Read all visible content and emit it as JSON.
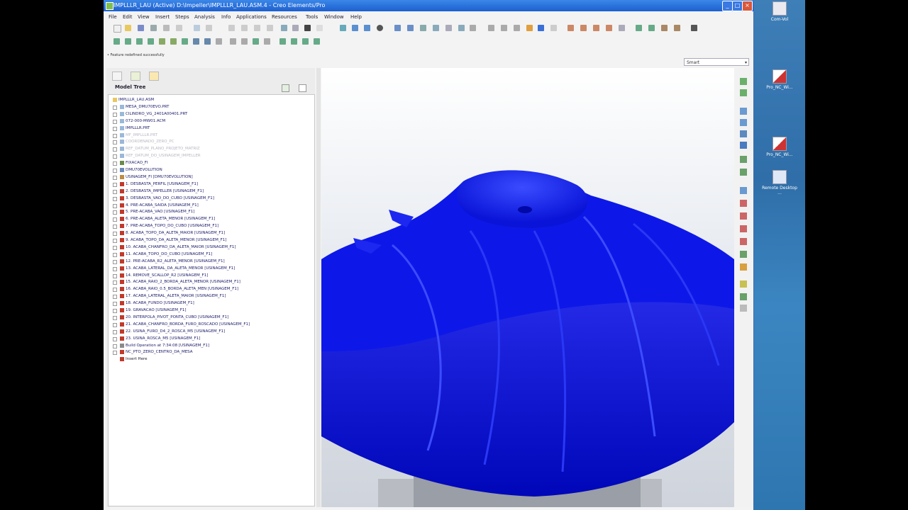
{
  "window": {
    "title": "IMPLLLR_LAU (Active) D:\\Impeller\\IMPLLLR_LAU.ASM.4 - Creo Elements/Pro",
    "minimize": "_",
    "maximize": "□",
    "close": "×"
  },
  "menu": [
    "File",
    "Edit",
    "View",
    "Insert",
    "Steps",
    "Analysis",
    "Info",
    "Applications",
    "Resources",
    "Tools",
    "Window",
    "Help"
  ],
  "status_message": "• Feature redefined successfully",
  "filter": {
    "value": "Smart"
  },
  "model_tree": {
    "title": "Model Tree",
    "rows": [
      {
        "text": "IMPLLLR_LAU.ASM",
        "dim": false,
        "icon": "assembly-icon",
        "indent": 0
      },
      {
        "text": "MESA_DMU70EVO.PRT",
        "dim": false,
        "icon": "part-icon",
        "indent": 1
      },
      {
        "text": "CILINDRO_VG_2401A00401.PRT",
        "dim": false,
        "icon": "part-icon",
        "indent": 1
      },
      {
        "text": "072-000-MW01.ACM",
        "dim": false,
        "icon": "part-icon",
        "indent": 1
      },
      {
        "text": "IMPLLLR.PRT",
        "dim": false,
        "icon": "part-icon",
        "indent": 1
      },
      {
        "text": "MF_IMPLLLR.PRT",
        "dim": true,
        "icon": "part-icon",
        "indent": 1
      },
      {
        "text": "COORDENADO_ZERO_PC",
        "dim": true,
        "icon": "part-icon",
        "indent": 1
      },
      {
        "text": "REF_DATUM_PLANO_PROJETO_MATRIZ",
        "dim": true,
        "icon": "part-icon",
        "indent": 1
      },
      {
        "text": "REF_DATUM_DO_USINAGEM_IMPELLER",
        "dim": true,
        "icon": "part-icon",
        "indent": 1
      },
      {
        "text": "FIXACAO_FI",
        "dim": false,
        "icon": "fixture-icon",
        "indent": 1
      },
      {
        "text": "DMU70EVOLUTION",
        "dim": false,
        "icon": "machine-icon",
        "indent": 1
      },
      {
        "text": "USINAGEM_FI [DMU70EVOLUTION]",
        "dim": false,
        "icon": "operation-icon",
        "indent": 1
      },
      {
        "text": "1. DESBASTA_PERFIL [USINAGEM_F1]",
        "dim": false,
        "icon": "sequence-icon",
        "indent": 1
      },
      {
        "text": "2. DESBASTA_IMPELLER [USINAGEM_F1]",
        "dim": false,
        "icon": "sequence-icon",
        "indent": 1
      },
      {
        "text": "3. DESBASTA_VAO_DO_CUBO [USINAGEM_F1]",
        "dim": false,
        "icon": "sequence-icon",
        "indent": 1
      },
      {
        "text": "4. PRE-ACABA_SAIDA [USINAGEM_F1]",
        "dim": false,
        "icon": "sequence-icon",
        "indent": 1
      },
      {
        "text": "5. PRE-ACABA_VAO [USINAGEM_F1]",
        "dim": false,
        "icon": "sequence-icon",
        "indent": 1
      },
      {
        "text": "6. PRE-ACABA_ALETA_MENOR [USINAGEM_F1]",
        "dim": false,
        "icon": "sequence-icon",
        "indent": 1
      },
      {
        "text": "7. PRE-ACABA_TOPO_DO_CUBO [USINAGEM_F1]",
        "dim": false,
        "icon": "sequence-icon",
        "indent": 1
      },
      {
        "text": "8. ACABA_TOPO_DA_ALETA_MAIOR [USINAGEM_F1]",
        "dim": false,
        "icon": "sequence-icon",
        "indent": 1
      },
      {
        "text": "9. ACABA_TOPO_DA_ALETA_MENOR [USINAGEM_F1]",
        "dim": false,
        "icon": "sequence-icon",
        "indent": 1
      },
      {
        "text": "10. ACABA_CHANFRO_DA_ALETA_MAIOR [USINAGEM_F1]",
        "dim": false,
        "icon": "sequence-icon",
        "indent": 1
      },
      {
        "text": "11. ACABA_TOPO_DO_CUBO [USINAGEM_F1]",
        "dim": false,
        "icon": "sequence-icon",
        "indent": 1
      },
      {
        "text": "12. PRE-ACABA_R2_ALETA_MENOR [USINAGEM_F1]",
        "dim": false,
        "icon": "sequence-icon",
        "indent": 1
      },
      {
        "text": "13. ACABA_LATERAL_DA_ALETA_MENOR [USINAGEM_F1]",
        "dim": false,
        "icon": "sequence-icon",
        "indent": 1
      },
      {
        "text": "14. REMOVE_SCALLOP_R2 [USINAGEM_F1]",
        "dim": false,
        "icon": "sequence-icon",
        "indent": 1
      },
      {
        "text": "15. ACABA_RAIO_2_BORDA_ALETA_MENOR [USINAGEM_F1]",
        "dim": false,
        "icon": "sequence-icon",
        "indent": 1
      },
      {
        "text": "16. ACABA_RAIO_0.5_BORDA_ALETA_MEN [USINAGEM_F1]",
        "dim": false,
        "icon": "sequence-icon",
        "indent": 1
      },
      {
        "text": "17. ACABA_LATERAL_ALETA_MAIOR [USINAGEM_F1]",
        "dim": false,
        "icon": "sequence-icon",
        "indent": 1
      },
      {
        "text": "18. ACABA_FUNDO [USINAGEM_F1]",
        "dim": false,
        "icon": "sequence-icon",
        "indent": 1
      },
      {
        "text": "19. GRAVACAO [USINAGEM_F1]",
        "dim": false,
        "icon": "sequence-icon",
        "indent": 1
      },
      {
        "text": "20. INTERPOLA_PIVOT_PONTA_CUBO [USINAGEM_F1]",
        "dim": false,
        "icon": "sequence-icon",
        "indent": 1
      },
      {
        "text": "21. ACABA_CHANFRO_BORDA_FURO_ROSCADO [USINAGEM_F1]",
        "dim": false,
        "icon": "sequence-icon",
        "indent": 1
      },
      {
        "text": "22. USINA_FURO_D4_2_ROSCA_M5 [USINAGEM_F1]",
        "dim": false,
        "icon": "sequence-icon",
        "indent": 1
      },
      {
        "text": "23. USINA_ROSCA_M5 [USINAGEM_F1]",
        "dim": false,
        "icon": "sequence-icon",
        "indent": 1
      },
      {
        "text": "Build Operation at 7:34:08 [USINAGEM_F1]",
        "dim": false,
        "icon": "build-icon",
        "indent": 1
      },
      {
        "text": "NC_PTO_ZERO_CENTRO_DA_MESA",
        "dim": false,
        "icon": "csys-icon",
        "indent": 1
      },
      {
        "text": "Insert Here",
        "dim": false,
        "icon": "insert-here-icon",
        "indent": 1,
        "insert": true
      }
    ]
  },
  "desktop_icons": [
    {
      "label": "Com-Vol"
    },
    {
      "label": "Pro_NC_Wi..."
    },
    {
      "label": "Pro_NC_Wi..."
    },
    {
      "label": "Remote Desktop ..."
    }
  ],
  "colors": {
    "title_bar": "#1d5fd0",
    "model_blue": "#0a14e6",
    "tree_text": "#1a1a6a",
    "sequence_icon": "#c0392b"
  }
}
